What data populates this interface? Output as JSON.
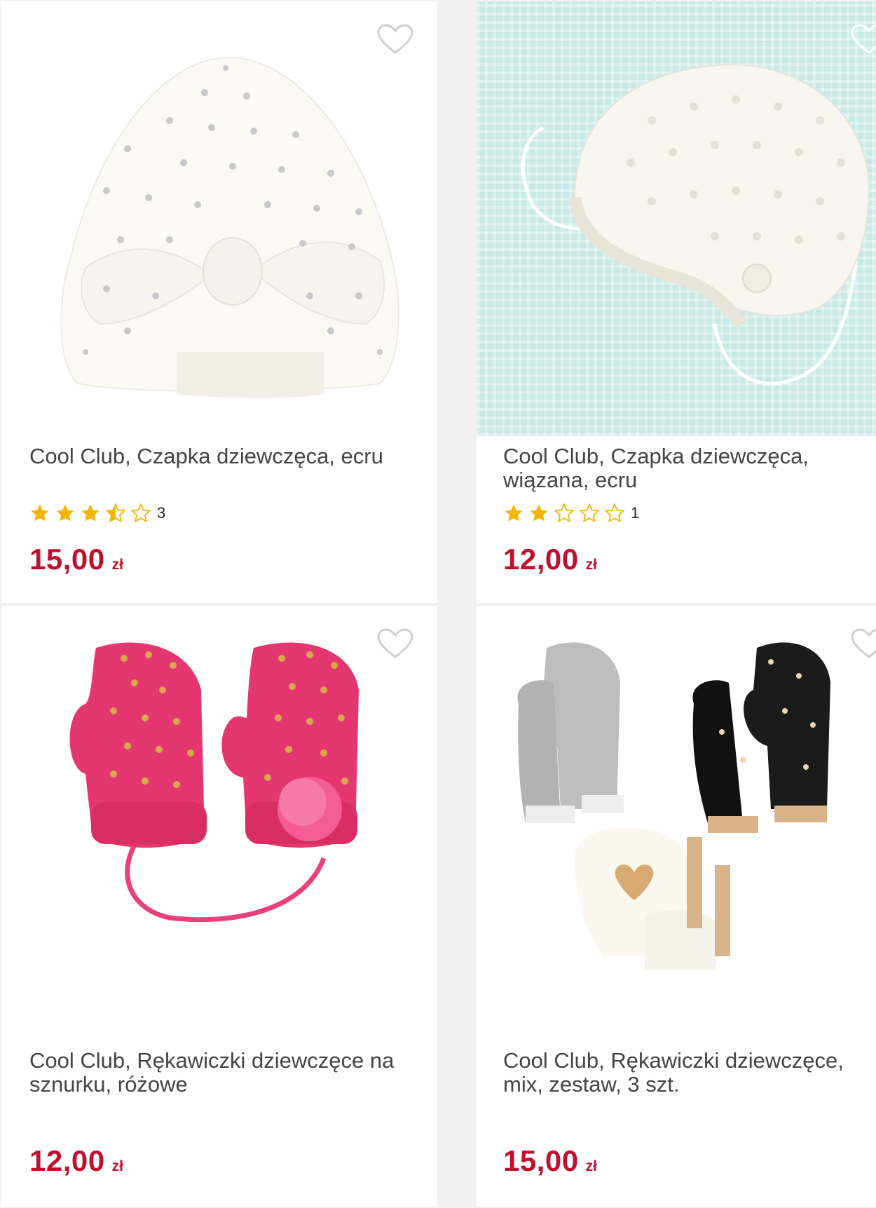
{
  "products": [
    {
      "title": "Cool Club, Czapka dziewczęca, ecru",
      "rating": 3.5,
      "rating_count": "3",
      "price": "15,00",
      "currency": "zł",
      "image_icon": "white-turban-hat-image"
    },
    {
      "title": "Cool Club, Czapka dziewczęca, wiązana, ecru",
      "rating": 2,
      "rating_count": "1",
      "price": "12,00",
      "currency": "zł",
      "image_icon": "white-knit-bonnet-image"
    },
    {
      "title": "Cool Club, Rękawiczki dziewczęce na sznurku, różowe",
      "price": "12,00",
      "currency": "zł",
      "image_icon": "pink-mittens-image"
    },
    {
      "title": "Cool Club, Rękawiczki dziewczęce, mix, zestaw, 3 szt.",
      "price": "15,00",
      "currency": "zł",
      "image_icon": "mittens-set-image"
    }
  ],
  "colors": {
    "price": "#c0102f",
    "title": "#444444",
    "star_filled": "#f2b705",
    "star_empty": "#f2b705"
  },
  "icons": {
    "favorite": "heart-outline-icon",
    "star": "star-icon"
  }
}
